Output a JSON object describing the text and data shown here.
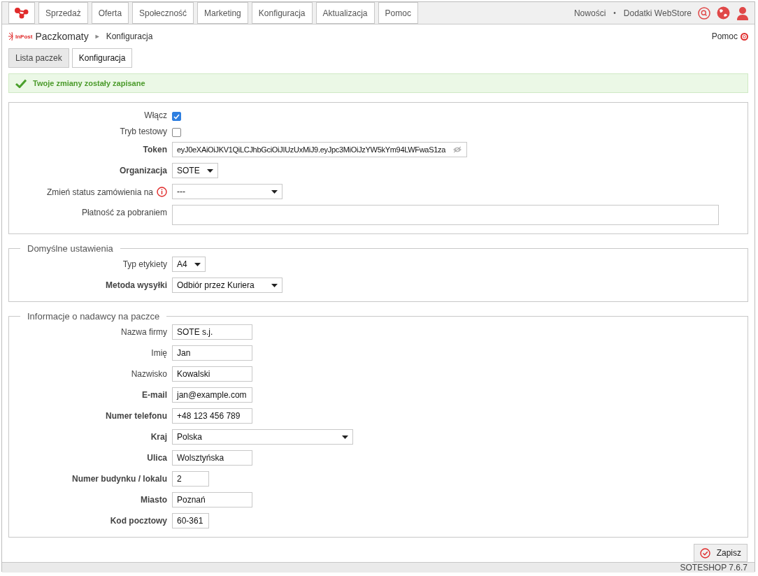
{
  "nav": {
    "items": [
      {
        "label": "Sprzedaż"
      },
      {
        "label": "Oferta"
      },
      {
        "label": "Społeczność"
      },
      {
        "label": "Marketing"
      },
      {
        "label": "Konfiguracja"
      },
      {
        "label": "Aktualizacja"
      },
      {
        "label": "Pomoc"
      }
    ],
    "links": [
      "Nowości",
      "•",
      "Dodatki WebStore"
    ]
  },
  "breadcrumb": {
    "logo_text": "InPost",
    "title": "Paczkomaty",
    "separator": "►",
    "current": "Konfiguracja",
    "help": "Pomoc"
  },
  "tabs": [
    {
      "label": "Lista paczek",
      "selected": false
    },
    {
      "label": "Konfiguracja",
      "selected": true
    }
  ],
  "alert": "Twoje zmiany zostały zapisane",
  "sections": [
    {
      "fields": [
        {
          "label": "Włącz",
          "bold": false,
          "kind": "checkbox",
          "checked": true
        },
        {
          "label": "Tryb testowy",
          "bold": false,
          "kind": "checkbox",
          "checked": false
        },
        {
          "label": "Token",
          "bold": true,
          "kind": "token",
          "value": "eyJ0eXAiOiJKV1QiLCJhbGciOiJIUzUxMiJ9.eyJpc3MiOiJzYW5kYm94LWFwaS1za"
        },
        {
          "label": "Organizacja",
          "bold": true,
          "kind": "dropdown",
          "value": "SOTE"
        },
        {
          "label": "Zmień status zamówienia na",
          "bold": false,
          "kind": "select",
          "value": "---",
          "info": true
        },
        {
          "label": "Płatność za pobraniem",
          "bold": false,
          "kind": "textarea"
        }
      ]
    },
    {
      "legend": "Domyślne ustawienia",
      "fields": [
        {
          "label": "Typ etykiety",
          "bold": false,
          "kind": "dropdown",
          "value": "A4"
        },
        {
          "label": "Metoda wysyłki",
          "bold": true,
          "kind": "select",
          "value": "Odbiór przez Kuriera"
        }
      ]
    },
    {
      "legend": "Informacje o nadawcy na paczce",
      "fields": [
        {
          "label": "Nazwa firmy",
          "bold": false,
          "kind": "text",
          "value": "SOTE s.j."
        },
        {
          "label": "Imię",
          "bold": false,
          "kind": "text",
          "value": "Jan"
        },
        {
          "label": "Nazwisko",
          "bold": false,
          "kind": "text",
          "value": "Kowalski"
        },
        {
          "label": "E-mail",
          "bold": true,
          "kind": "text",
          "value": "jan@example.com"
        },
        {
          "label": "Numer telefonu",
          "bold": true,
          "kind": "text",
          "value": "+48 123 456 789"
        },
        {
          "label": "Kraj",
          "bold": true,
          "kind": "wideselect",
          "value": "Polska"
        },
        {
          "label": "Ulica",
          "bold": true,
          "kind": "text",
          "value": "Wolsztyńska"
        },
        {
          "label": "Numer budynku / lokalu",
          "bold": true,
          "kind": "shorttext",
          "value": "2"
        },
        {
          "label": "Miasto",
          "bold": true,
          "kind": "text",
          "value": "Poznań"
        },
        {
          "label": "Kod pocztowy",
          "bold": true,
          "kind": "shorttext",
          "value": "60-361"
        }
      ]
    }
  ],
  "save_button": "Zapisz",
  "footer": "SOTESHOP 7.6.7"
}
